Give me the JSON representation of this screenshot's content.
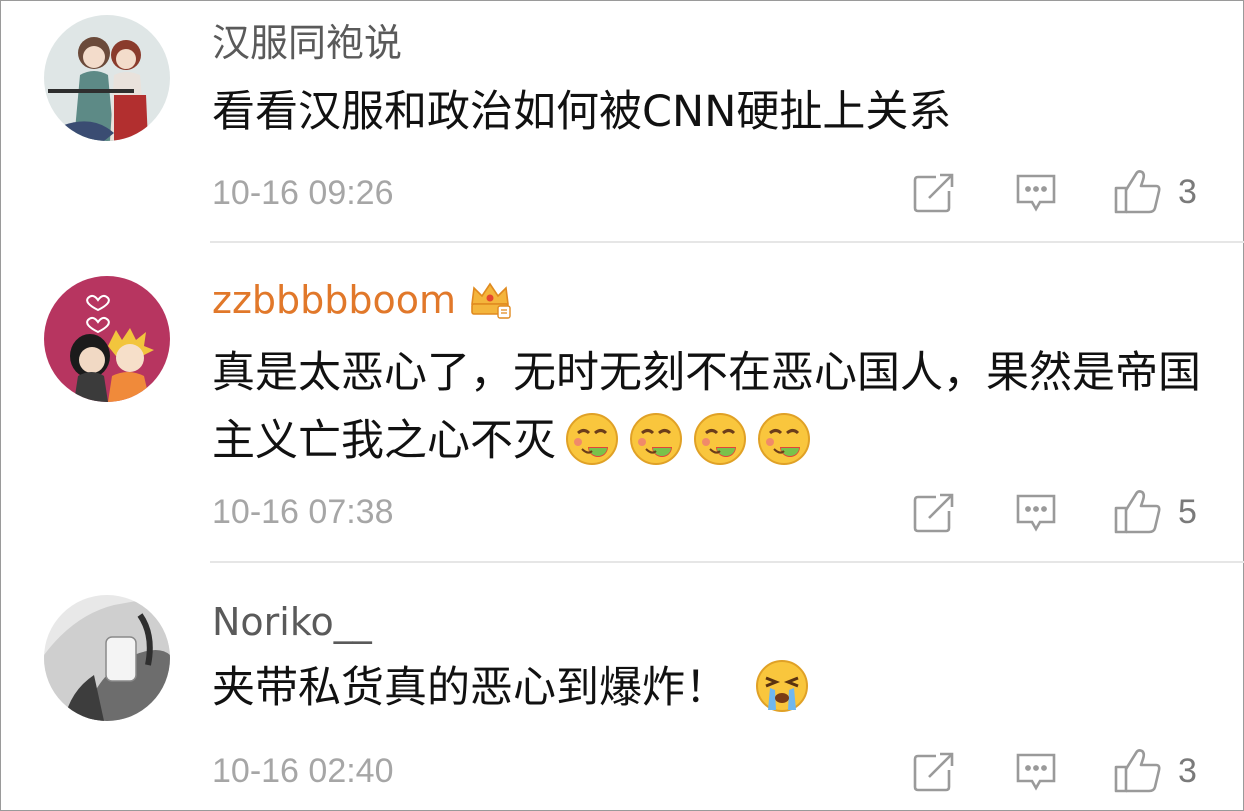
{
  "comments": [
    {
      "username": "汉服同袍说",
      "text": "看看汉服和政治如何被CNN硬扯上关系",
      "time": "10-16 09:26",
      "likes": "3",
      "vip": false
    },
    {
      "username": "zzbbbbboom",
      "text": "真是太恶心了，无时无刻不在恶心国人，果然是帝国主义亡我之心不灭",
      "time": "10-16 07:38",
      "likes": "5",
      "vip": true,
      "emojis": [
        "yummy-emoji",
        "yummy-emoji",
        "yummy-emoji",
        "yummy-emoji"
      ]
    },
    {
      "username": "Noriko__",
      "text": "夹带私货真的恶心到爆炸！",
      "time": "10-16 02:40",
      "likes": "3",
      "vip": false,
      "emojis": [
        "crying-emoji"
      ]
    }
  ],
  "icons": {
    "forward": "forward-icon",
    "reply": "reply-icon",
    "like": "thumbs-up-icon",
    "vip": "crown-badge-icon"
  },
  "colors": {
    "username": "#5a5a5a",
    "vip_username": "#e1782a",
    "timestamp": "#a6a6a6",
    "text": "#111111",
    "divider": "#e6e6e6"
  }
}
